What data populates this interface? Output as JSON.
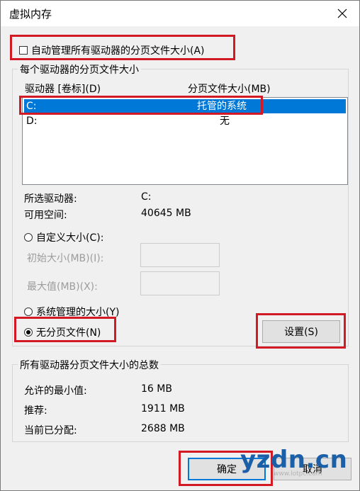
{
  "window": {
    "title": "虚拟内存"
  },
  "auto_manage": {
    "label": "自动管理所有驱动器的分页文件大小(A)",
    "checked": false
  },
  "per_drive_group": {
    "legend": "每个驱动器的分页文件大小",
    "columns": [
      "驱动器 [卷标](D)",
      "分页文件大小(MB)"
    ],
    "rows": [
      {
        "drive": "C:",
        "size": "托管的系统",
        "selected": true
      },
      {
        "drive": "D:",
        "size": "无",
        "selected": false
      }
    ],
    "selected_drive_label": "所选驱动器:",
    "selected_drive_value": "C:",
    "free_space_label": "可用空间:",
    "free_space_value": "40645 MB",
    "custom_size_label": "自定义大小(C):",
    "initial_size_label": "初始大小(MB)(I):",
    "max_size_label": "最大值(MB)(X):",
    "system_managed_label": "系统管理的大小(Y)",
    "no_paging_label": "无分页文件(N)",
    "selected_option": "no_paging",
    "set_button": "设置(S)"
  },
  "total_group": {
    "legend": "所有驱动器分页文件大小的总数",
    "min_allowed_label": "允许的最小值:",
    "min_allowed_value": "16 MB",
    "recommended_label": "推荐:",
    "recommended_value": "1911 MB",
    "current_label": "当前已分配:",
    "current_value": "2688 MB"
  },
  "footer": {
    "ok_button": "确定",
    "cancel_button": "取消"
  },
  "watermark": {
    "text": "yzdn.cn",
    "sub": "www.lotpc.com"
  },
  "colors": {
    "highlight": "#d31a24",
    "selection": "#0078d7",
    "window_bg": "#f0f0f0"
  }
}
